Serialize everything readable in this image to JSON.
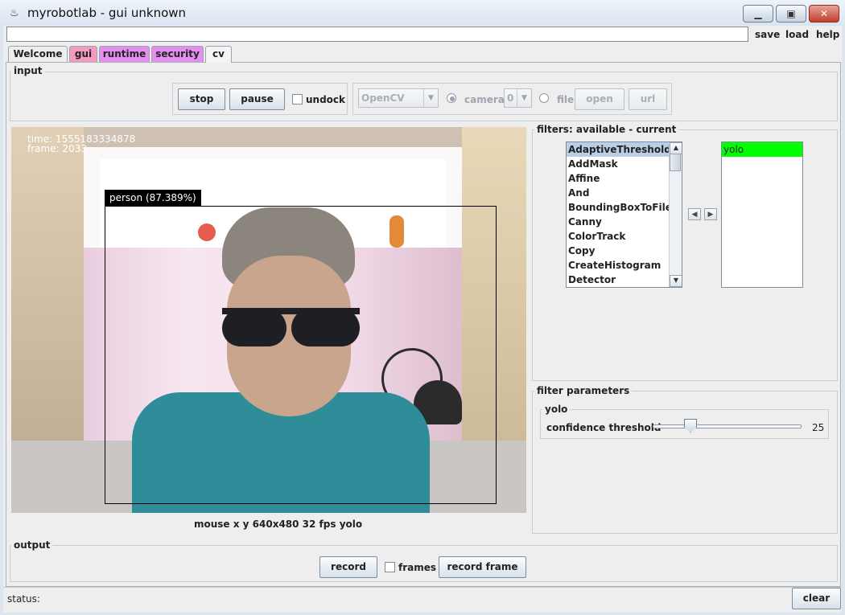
{
  "window": {
    "title": "myrobotlab - gui unknown",
    "controls": {
      "minimize": "▁",
      "maximize": "▣",
      "close": "✕"
    }
  },
  "command_input": {
    "value": ""
  },
  "menu": {
    "save": "save",
    "load": "load",
    "help": "help"
  },
  "tabs": [
    {
      "label": "Welcome",
      "color": "#eeeeee"
    },
    {
      "label": "gui",
      "color": "#f49ac0"
    },
    {
      "label": "runtime",
      "color": "#e48ef0"
    },
    {
      "label": "security",
      "color": "#e48ef0"
    },
    {
      "label": "cv",
      "color": "#f4f4f4",
      "selected": true
    }
  ],
  "input": {
    "title": "input",
    "stop": "stop",
    "pause": "pause",
    "undock": "undock",
    "undock_checked": false,
    "grabber_selected": "OpenCV",
    "camera": "camera",
    "camera_index": "0",
    "camera_selected": true,
    "file": "file",
    "open": "open",
    "url": "url"
  },
  "video": {
    "time": "time: 1555183334878",
    "frame": "frame: 2033",
    "detection_label": "person (87.389%)",
    "status": "mouse x y  640x480  32 fps  yolo"
  },
  "filters": {
    "title": "filters: available - current",
    "available": [
      "AdaptiveThreshold",
      "AddMask",
      "Affine",
      "And",
      "BoundingBoxToFile",
      "Canny",
      "ColorTrack",
      "Copy",
      "CreateHistogram",
      "Detector"
    ],
    "available_selected": "AdaptiveThreshold",
    "current": [
      "yolo"
    ],
    "current_highlight_color": "#00ff00",
    "move_left": "◀",
    "move_right": "▶"
  },
  "filter_parameters": {
    "title": "filter parameters",
    "filter_name": "yolo",
    "confidence_label": "confidence threshold",
    "confidence_value": "25",
    "confidence_fraction": 0.25
  },
  "output": {
    "title": "output",
    "record": "record",
    "frames": "frames",
    "frames_checked": false,
    "record_frame": "record frame"
  },
  "status_bar": {
    "status": "status:",
    "clear": "clear"
  }
}
